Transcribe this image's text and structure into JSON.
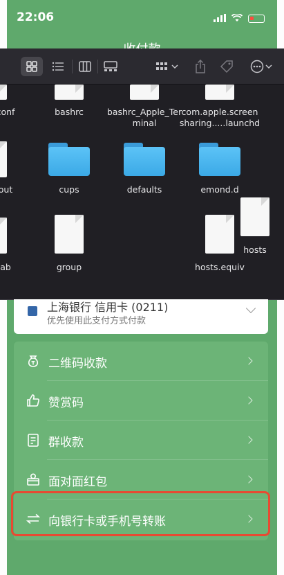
{
  "status_bar": {
    "time": "22:06"
  },
  "header": {
    "title": "收付款"
  },
  "finder": {
    "files": [
      {
        "name": "conf",
        "kind": "document"
      },
      {
        "name": "bashrc",
        "kind": "document"
      },
      {
        "name": "bashrc_Apple_Terminal",
        "kind": "document"
      },
      {
        "name": "com.apple.screensharing.....launchd",
        "kind": "document"
      },
      {
        "name": "out",
        "kind": "document"
      },
      {
        "name": "cups",
        "kind": "folder"
      },
      {
        "name": "defaults",
        "kind": "folder"
      },
      {
        "name": "emond.d",
        "kind": "folder"
      },
      {
        "name": "hosts",
        "kind": "document"
      },
      {
        "name": "ab",
        "kind": "document"
      },
      {
        "name": "group",
        "kind": "document"
      },
      {
        "name": "hosts.equiv",
        "kind": "document"
      }
    ],
    "file_labels": {
      "conf": "conf",
      "bashrc": "bashrc",
      "bashrc_apple_terminal_1": "bashrc_Apple_Ter",
      "bashrc_apple_terminal_2": "minal",
      "com_apple_1": "com.apple.screen",
      "com_apple_2": "sharing.....launchd",
      "out": "out",
      "cups": "cups",
      "defaults": "defaults",
      "emond": "emond.d",
      "hosts": "hosts",
      "ab": "ab",
      "group": "group",
      "hosts_equiv": "hosts.equiv"
    },
    "toolbar": {
      "view_modes": [
        "icon-view",
        "list-view",
        "column-view",
        "gallery-view"
      ],
      "active_view": "icon-view",
      "buttons": [
        "group-by",
        "share",
        "tag",
        "more-actions"
      ]
    }
  },
  "payment": {
    "card_name": "上海银行 信用卡 (0211)",
    "subtitle": "优先使用此支付方式付款"
  },
  "menu": {
    "items": [
      {
        "label": "二维码收款",
        "icon": "money-bag-icon"
      },
      {
        "label": "赞赏码",
        "icon": "thumbs-up-icon"
      },
      {
        "label": "群收款",
        "icon": "group-receipt-icon"
      },
      {
        "label": "面对面红包",
        "icon": "red-packet-icon"
      },
      {
        "label": "向银行卡或手机号转账",
        "icon": "transfer-icon"
      }
    ]
  },
  "colors": {
    "background": "#5fa96c",
    "menu_bg": "#6cb477",
    "finder_bg": "#201f24",
    "highlight": "#e84a32"
  }
}
